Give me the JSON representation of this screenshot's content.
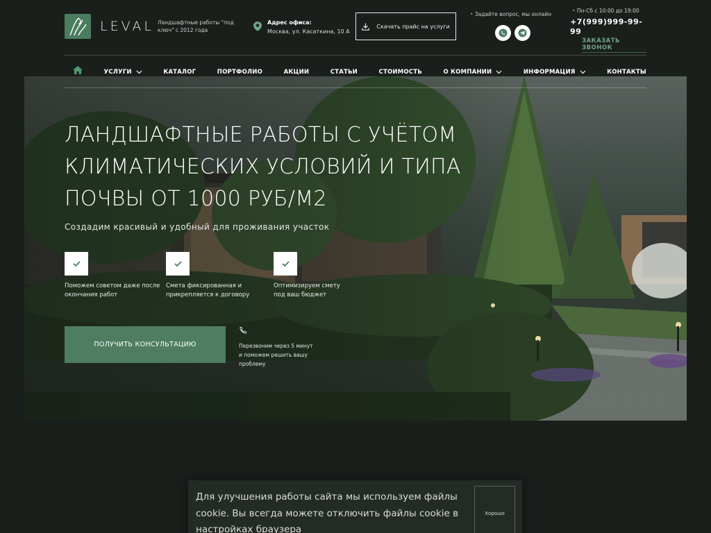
{
  "header": {
    "logo_text": "LEVAL",
    "tagline": "Ландшафтные работы \"под ключ\" с 2012 года",
    "office_label": "Адрес офиса:",
    "office_address": "Москва, ул. Касаткина, 10 А",
    "price_button": "Скачать прайс на услуги",
    "ask_text": "Задайте вопрос, мы онлайн",
    "hours": "Пн-Сб с 10:00 до 19:00",
    "phone": "+7(999)999-99-99",
    "callback": "ЗАКАЗАТЬ ЗВОНОК",
    "icons": [
      "logo-icon",
      "map-pin-icon",
      "download-icon",
      "whatsapp-icon",
      "telegram-icon"
    ]
  },
  "nav": {
    "items": [
      {
        "label": "УСЛУГИ",
        "dropdown": true
      },
      {
        "label": "КАТАЛОГ",
        "dropdown": false
      },
      {
        "label": "ПОРТФОЛИО",
        "dropdown": false
      },
      {
        "label": "АКЦИИ",
        "dropdown": false
      },
      {
        "label": "СТАТЬИ",
        "dropdown": false
      },
      {
        "label": "СТОИМОСТЬ",
        "dropdown": false
      },
      {
        "label": "О КОМПАНИИ",
        "dropdown": true
      },
      {
        "label": "ИНФОРМАЦИЯ",
        "dropdown": true
      },
      {
        "label": "КОНТАКТЫ",
        "dropdown": false
      }
    ]
  },
  "hero": {
    "title": "ЛАНДШАФТНЫЕ РАБОТЫ С УЧЁТОМ КЛИМАТИЧЕСКИХ УСЛОВИЙ И ТИПА ПОЧВЫ ОТ 1000 РУБ/М2",
    "subtitle": "Создадим красивый и удобный для проживания участок",
    "features": [
      "Поможем советом даже после окончания работ",
      "Смета фиксированная и прикрепляется к договору",
      "Оптимизируем смету под ваш бюджет"
    ],
    "cta": "ПОЛУЧИТЬ КОНСУЛЬТАЦИЮ",
    "callback_note": "Перезвоним через 5 минут и поможем решить вашу проблему"
  },
  "cookie": {
    "text": "Для улучшения работы сайта мы используем файлы cookie. Вы всегда можете отключить файлы cookie в настройках браузера",
    "button": "Хорошо"
  },
  "colors": {
    "background": "#1a1f1c",
    "accent": "#4e7d62",
    "accent_light": "#6fa486"
  }
}
